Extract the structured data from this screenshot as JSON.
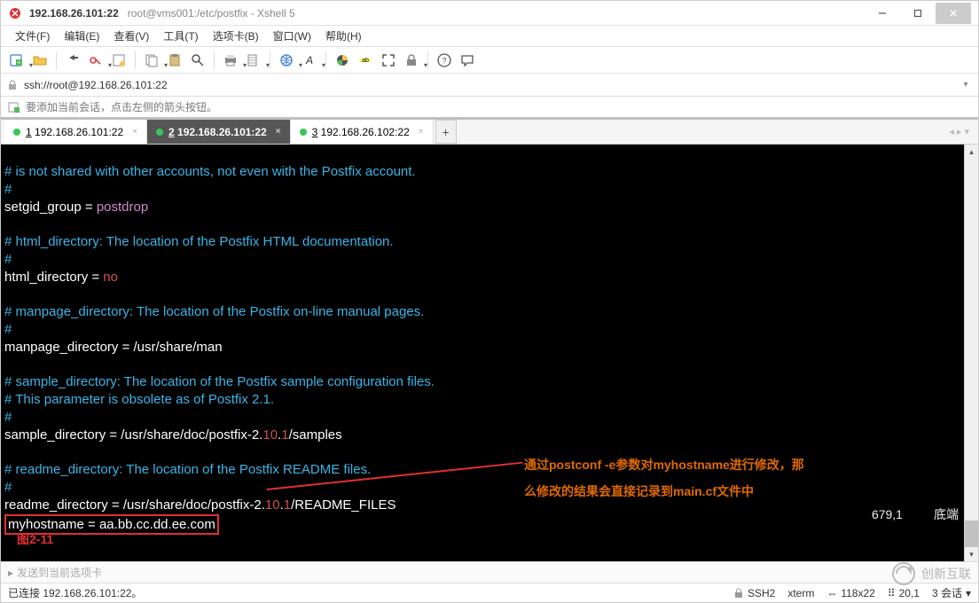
{
  "title": {
    "ip": "192.168.26.101:22",
    "path": "root@vms001:/etc/postfix - Xshell 5"
  },
  "menu": {
    "file": "文件(F)",
    "edit": "编辑(E)",
    "view": "查看(V)",
    "tools": "工具(T)",
    "tabs": "选项卡(B)",
    "window": "窗口(W)",
    "help": "帮助(H)"
  },
  "address": "ssh://root@192.168.26.101:22",
  "hint": "要添加当前会话，点击左侧的箭头按钮。",
  "tabs": [
    {
      "num": "1",
      "label": "192.168.26.101:22"
    },
    {
      "num": "2",
      "label": "192.168.26.101:22"
    },
    {
      "num": "3",
      "label": "192.168.26.102:22"
    }
  ],
  "terminal": {
    "l01": "# is not shared with other accounts, not even with the Postfix account.",
    "l02": "#",
    "l03a": "setgid_group = ",
    "l03b": "postdrop",
    "l05": "# html_directory: The location of the Postfix HTML documentation.",
    "l06": "#",
    "l07a": "html_directory = ",
    "l07b": "no",
    "l09": "# manpage_directory: The location of the Postfix on-line manual pages.",
    "l10": "#",
    "l11": "manpage_directory = /usr/share/man",
    "l13": "# sample_directory: The location of the Postfix sample configuration files.",
    "l14": "# This parameter is obsolete as of Postfix 2.1.",
    "l15": "#",
    "l16a": "sample_directory = /usr/share/doc/postfix-2.",
    "l16b": "10",
    "l16c": ".",
    "l16d": "1",
    "l16e": "/samples",
    "l18": "# readme_directory: The location of the Postfix README files.",
    "l19": "#",
    "l20a": "readme_directory = /usr/share/doc/postfix-2.",
    "l20b": "10",
    "l20c": ".",
    "l20d": "1",
    "l20e": "/README_FILES",
    "l21": "myhostname = aa.bb.cc.dd.ee.com",
    "posline": "679,1",
    "poslabel": "底端",
    "annot1": "通过postconf -e参数对myhostname进行修改，那",
    "annot2": "么修改的结果会直接记录到main.cf文件中",
    "figlabel": "图2-11"
  },
  "inputhint_prefix": "",
  "inputhint": "发送到当前选项卡",
  "status": {
    "left": "已连接 192.168.26.101:22。",
    "ssh": "SSH2",
    "term": "xterm",
    "size_icon": "⇔",
    "size": "118x22",
    "cursor_icon": "⠿",
    "cursor": "20,1",
    "sessions": "3 会话",
    "sessions_drop": "▾"
  },
  "watermark": "创新互联"
}
